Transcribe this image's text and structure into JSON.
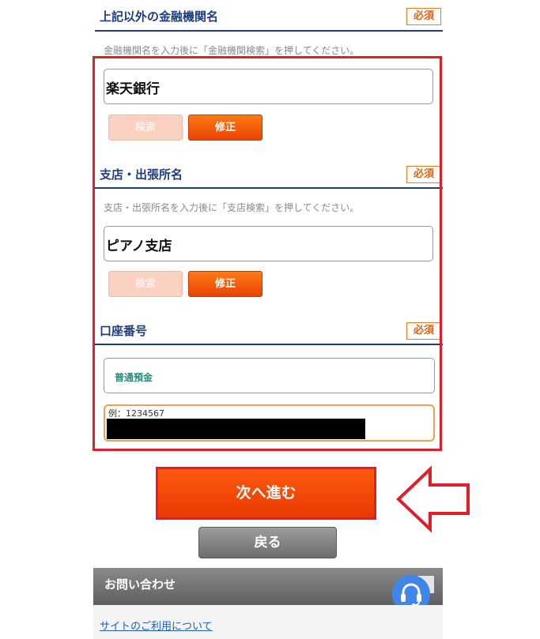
{
  "section1": {
    "title": "上記以外の金融機関名",
    "badge": "必須"
  },
  "hint1": "金融機関名を入力後に「金融機関検索」を押してください。",
  "bank_field": {
    "value": "楽天銀行"
  },
  "bank_buttons": {
    "search": "検索",
    "fix": "修正"
  },
  "section2": {
    "title": "支店・出張所名",
    "badge": "必須"
  },
  "hint2": "支店・出張所名を入力後に「支店検索」を押してください。",
  "branch_field": {
    "value": "ピアノ支店"
  },
  "branch_buttons": {
    "search": "検索",
    "fix": "修正"
  },
  "section3": {
    "title": "口座番号",
    "badge": "必須"
  },
  "account_type": {
    "value": "普通預金"
  },
  "account_number": {
    "placeholder": "例：1234567"
  },
  "actions": {
    "next": "次へ進む",
    "back": "戻る"
  },
  "footer": {
    "contact": "お問い合わせ",
    "site_link": "サイトのご利用について"
  },
  "colors": {
    "accent": "#e84400",
    "highlight": "#e01e2a",
    "navy": "#1d3d7e",
    "support": "#3f86e8"
  },
  "icons": {
    "support": "headset-icon",
    "arrow": "left-arrow-icon"
  }
}
